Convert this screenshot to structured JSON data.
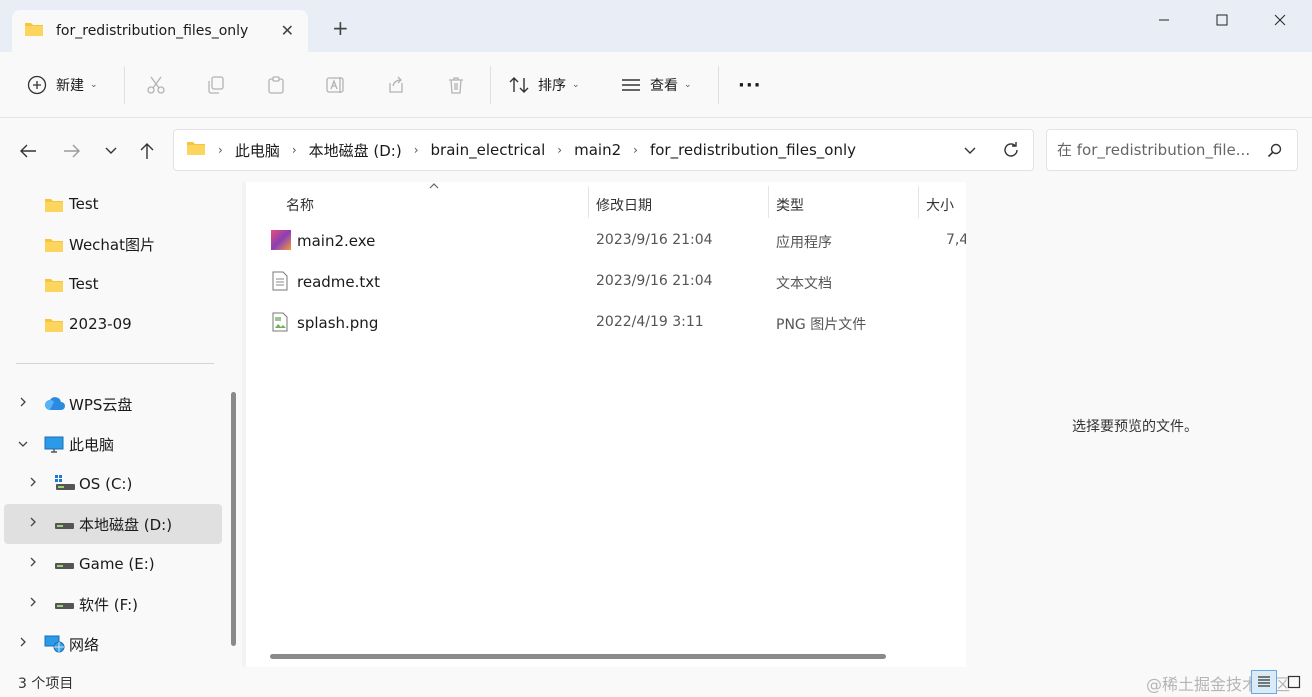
{
  "tab": {
    "title": "for_redistribution_files_only",
    "close": "✕",
    "new": "+"
  },
  "window": {
    "minimize": "—",
    "maximize": "☐",
    "close": "✕"
  },
  "toolbar": {
    "new_label": "新建",
    "sort_label": "排序",
    "view_label": "查看",
    "more": "···",
    "caret": "⌄"
  },
  "address": {
    "crumbs": [
      "此电脑",
      "本地磁盘 (D:)",
      "brain_electrical",
      "main2",
      "for_redistribution_files_only"
    ],
    "sep": "›"
  },
  "search": {
    "placeholder": "在 for_redistribution_file..."
  },
  "sidebar": {
    "items": [
      {
        "label": "Test"
      },
      {
        "label": "Wechat图片"
      },
      {
        "label": "Test"
      },
      {
        "label": "2023-09"
      },
      {
        "label": "WPS云盘"
      },
      {
        "label": "此电脑"
      },
      {
        "label": "OS (C:)"
      },
      {
        "label": "本地磁盘 (D:)"
      },
      {
        "label": "Game (E:)"
      },
      {
        "label": "软件 (F:)"
      },
      {
        "label": "网络"
      }
    ]
  },
  "columns": {
    "name": "名称",
    "date": "修改日期",
    "type": "类型",
    "size": "大小"
  },
  "files": [
    {
      "name": "main2.exe",
      "date": "2023/9/16 21:04",
      "type": "应用程序",
      "size": "7,4"
    },
    {
      "name": "readme.txt",
      "date": "2023/9/16 21:04",
      "type": "文本文档",
      "size": ""
    },
    {
      "name": "splash.png",
      "date": "2022/4/19 3:11",
      "type": "PNG 图片文件",
      "size": ""
    }
  ],
  "preview": {
    "text": "选择要预览的文件。"
  },
  "status": {
    "count": "3 个项目"
  },
  "watermark": "@稀土掘金技术社区",
  "colors": {
    "folder": "#f8c43a",
    "accent": "#0067c0",
    "selected": "#e0e0e0"
  }
}
